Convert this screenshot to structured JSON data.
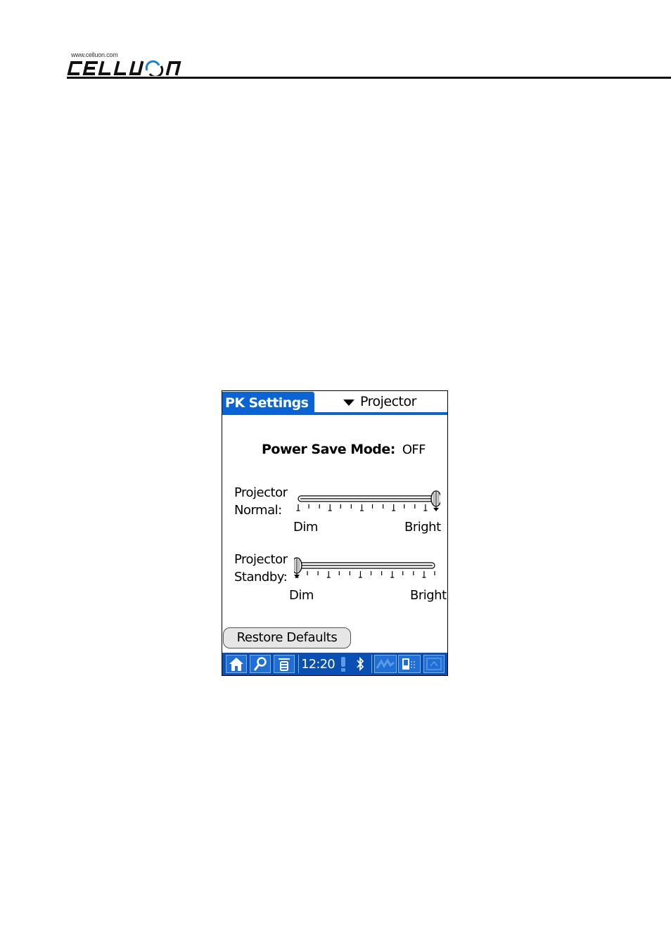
{
  "header": {
    "url": "www.celluon.com",
    "brand": "CELLUON"
  },
  "app": {
    "title": "PK Settings",
    "category": "Projector"
  },
  "power_save": {
    "label": "Power Save Mode:",
    "value": "OFF"
  },
  "sliders": [
    {
      "label_line1": "Projector",
      "label_line2": "Normal:",
      "min_label": "Dim",
      "max_label": "Bright",
      "level": 1.0,
      "ticks": 14
    },
    {
      "label_line1": "Projector",
      "label_line2": "Standby:",
      "min_label": "Dim",
      "max_label": "Bright",
      "level": 0.0,
      "ticks": 14
    }
  ],
  "restore_button": "Restore Defaults",
  "status_bar": {
    "time": "12:20",
    "icons": [
      "home-icon",
      "find-icon",
      "menu-icon",
      "alert-icon",
      "bluetooth-icon",
      "graffiti-icon",
      "device-icon",
      "input-toggle-icon"
    ]
  },
  "colors": {
    "accent": "#0a64d6",
    "status_bar": "#0a4fb3"
  }
}
